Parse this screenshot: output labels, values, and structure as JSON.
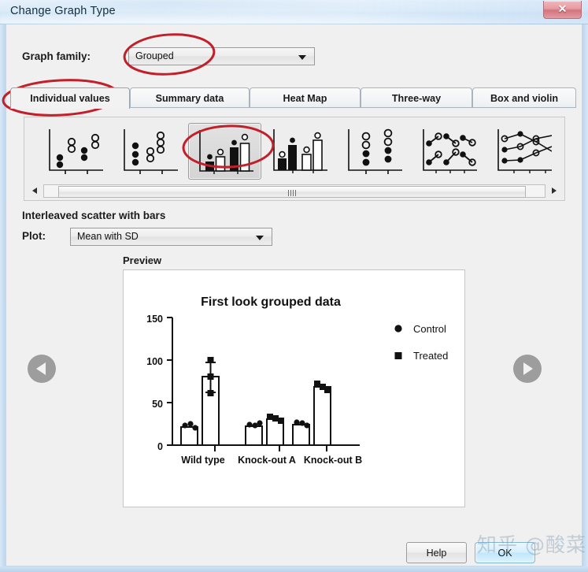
{
  "window": {
    "title": "Change Graph Type",
    "close_label": "✕"
  },
  "graph_family": {
    "label": "Graph family:",
    "value": "Grouped",
    "options": [
      "Grouped"
    ]
  },
  "tabs": [
    {
      "label": "Individual values",
      "active": true
    },
    {
      "label": "Summary data",
      "active": false
    },
    {
      "label": "Heat Map",
      "active": false
    },
    {
      "label": "Three-way",
      "active": false
    },
    {
      "label": "Box and violin",
      "active": false
    }
  ],
  "gallery": {
    "items": [
      {
        "name": "scatter-interleaved"
      },
      {
        "name": "scatter-grouped"
      },
      {
        "name": "interleaved-scatter-with-bars",
        "selected": true
      },
      {
        "name": "grouped-scatter-with-bars"
      },
      {
        "name": "scatter-stacked"
      },
      {
        "name": "before-after-pairs"
      },
      {
        "name": "before-after-lines"
      }
    ],
    "scrollbar": {
      "left_arrow": "◀",
      "right_arrow": "▶"
    }
  },
  "description": "Interleaved scatter with bars",
  "plot": {
    "label": "Plot:",
    "value": "Mean with SD",
    "options": [
      "Mean with SD"
    ]
  },
  "preview": {
    "label": "Preview",
    "prev_arrow": "◀",
    "next_arrow": "▶"
  },
  "footer": {
    "help_label": "Help",
    "ok_label": "OK"
  },
  "watermark": "知乎 @酸菜",
  "colors": {
    "annotation_red": "#c0202a",
    "titlebar_blue": "#cfe3f5",
    "dialog_gray": "#f0f0f0",
    "ok_blue": "#bfe6fb"
  },
  "chart_data": {
    "type": "bar",
    "title": "First look grouped data",
    "xlabel": "",
    "ylabel": "",
    "ylim": [
      0,
      150
    ],
    "yticks": [
      0,
      50,
      100,
      150
    ],
    "ytick_labels": [
      "0",
      "50",
      "100",
      "150"
    ],
    "grid": false,
    "legend_position": "right",
    "categories": [
      "Wild type",
      "Knock-out A",
      "Knock-out B"
    ],
    "series": [
      {
        "name": "Control",
        "marker": "circle",
        "values": [
          21,
          22,
          24
        ],
        "sd": [
          2,
          2,
          3
        ],
        "points": [
          [
            21,
            23,
            20
          ],
          [
            22,
            23,
            21
          ],
          [
            25,
            27,
            23
          ]
        ]
      },
      {
        "name": "Treated",
        "marker": "square",
        "values": [
          81,
          30,
          68
        ],
        "sd": [
          17,
          3,
          4
        ],
        "points": [
          [
            98,
            81,
            65
          ],
          [
            33,
            31,
            28
          ],
          [
            72,
            68,
            65
          ]
        ]
      }
    ],
    "legend": [
      "Control",
      "Treated"
    ]
  }
}
